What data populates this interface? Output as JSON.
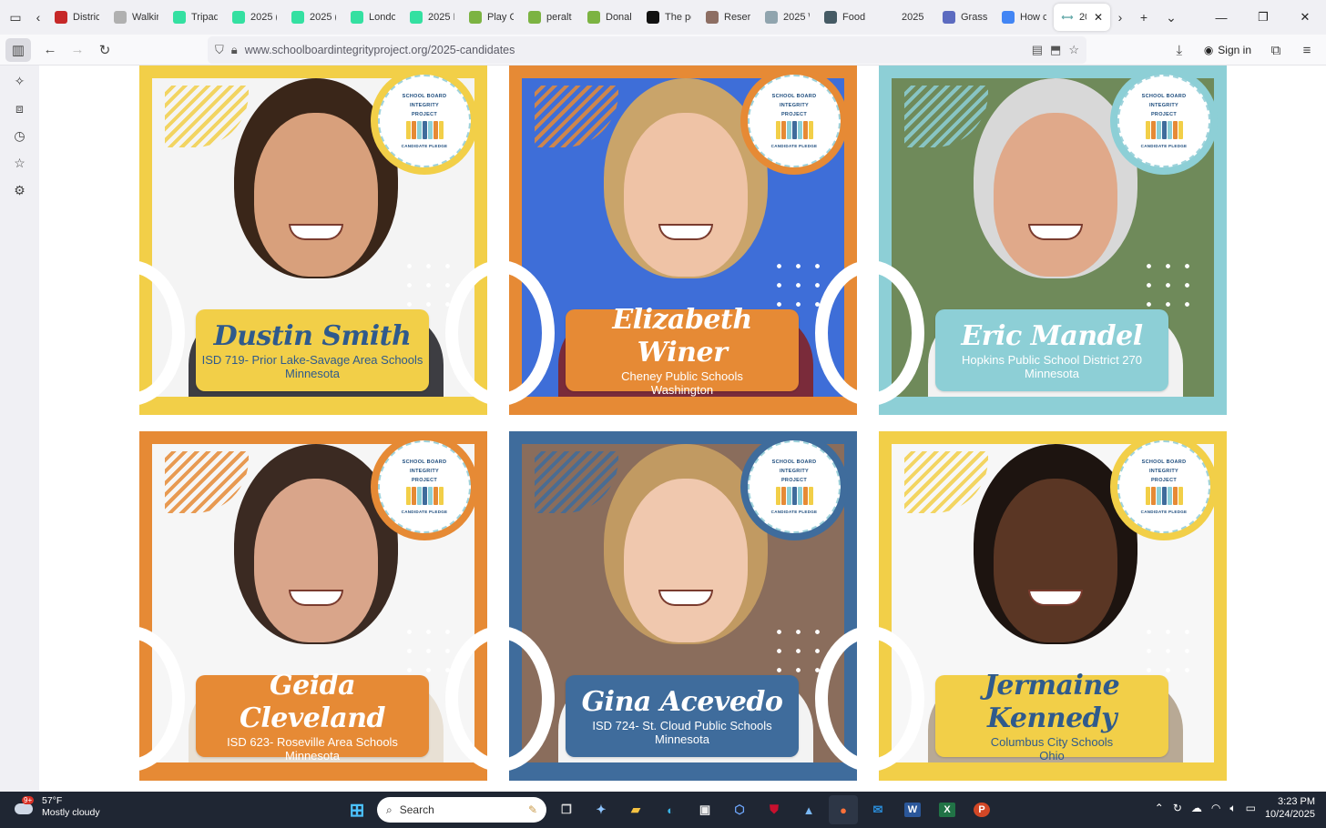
{
  "browser": {
    "tabs": [
      {
        "label": "Distric",
        "fav_color": "#c62828"
      },
      {
        "label": "Walkin",
        "fav_color": "#b0b0b0"
      },
      {
        "label": "Tripad",
        "fav_color": "#34e0a1"
      },
      {
        "label": "2025 (",
        "fav_color": "#34e0a1"
      },
      {
        "label": "2025 (",
        "fav_color": "#34e0a1"
      },
      {
        "label": "Londo",
        "fav_color": "#34e0a1"
      },
      {
        "label": "2025 I",
        "fav_color": "#34e0a1"
      },
      {
        "label": "Play C",
        "fav_color": "#7cb342"
      },
      {
        "label": "peralt",
        "fav_color": "#7cb342"
      },
      {
        "label": "Donal",
        "fav_color": "#7cb342"
      },
      {
        "label": "The pc",
        "fav_color": "#111111"
      },
      {
        "label": "Reserv",
        "fav_color": "#8d6e63"
      },
      {
        "label": "2025 \\",
        "fav_color": "#90a4ae"
      },
      {
        "label": "Food",
        "fav_color": "#455a64"
      },
      {
        "label": "2025",
        "fav_color": "#f0f0f4"
      },
      {
        "label": "Grass",
        "fav_color": "#5c6bc0"
      },
      {
        "label": "How c",
        "fav_color": "#4285f4"
      }
    ],
    "active_tab": {
      "label": "20"
    },
    "url": "www.schoolboardintegrityproject.org/2025-candidates",
    "sign_in": "Sign in"
  },
  "badge": {
    "title_lines": [
      "SCHOOL BOARD",
      "INTEGRITY",
      "PROJECT"
    ],
    "subtitle": "CANDIDATE PLEDGE"
  },
  "candidates": [
    {
      "name": "Dustin Smith",
      "district": "ISD 719- Prior Lake-Savage Area Schools",
      "state": "Minnesota",
      "frame_color": "#f2cf48",
      "plate_color": "#f2cf48",
      "name_color": "#2f5a8c",
      "text_color": "#2f5a8c",
      "bg": "#f4f4f4",
      "skin": "#d8a07c",
      "hair": "#3a2619",
      "shirt": "#3d3d42"
    },
    {
      "name": "Elizabeth Winer",
      "district": "Cheney Public Schools",
      "state": "Washington",
      "frame_color": "#e68a35",
      "plate_color": "#e68a35",
      "name_color": "#ffffff",
      "text_color": "#ffffff",
      "bg": "#3e6ed8",
      "skin": "#efc3a6",
      "hair": "#c9a46a",
      "shirt": "#7a2b3a"
    },
    {
      "name": "Eric Mandel",
      "district": "Hopkins Public School District 270",
      "state": "Minnesota",
      "frame_color": "#8dcfd6",
      "plate_color": "#8dcfd6",
      "name_color": "#ffffff",
      "text_color": "#ffffff",
      "bg": "#6f8a5a",
      "skin": "#e0a98a",
      "hair": "#d8d8d8",
      "shirt": "#f2f2f2"
    },
    {
      "name": "Geida Cleveland",
      "district": "ISD 623- Roseville Area Schools",
      "state": "Minnesota",
      "frame_color": "#e68a35",
      "plate_color": "#e68a35",
      "name_color": "#ffffff",
      "text_color": "#ffffff",
      "bg": "#f6f6f6",
      "skin": "#d9a58a",
      "hair": "#3b2a22",
      "shirt": "#e8e0d4"
    },
    {
      "name": "Gina Acevedo",
      "district": "ISD 724- St. Cloud Public Schools",
      "state": "Minnesota",
      "frame_color": "#3f6c9c",
      "plate_color": "#3f6c9c",
      "name_color": "#ffffff",
      "text_color": "#ffffff",
      "bg": "#8a6d5c",
      "skin": "#f0c8ae",
      "hair": "#c19a62",
      "shirt": "#f3f3f3"
    },
    {
      "name": "Jermaine Kennedy",
      "district": "Columbus City Schools",
      "state": "Ohio",
      "frame_color": "#f2cf48",
      "plate_color": "#f2cf48",
      "name_color": "#2f5a8c",
      "text_color": "#2f5a8c",
      "bg": "#f7f7f7",
      "skin": "#5a3624",
      "hair": "#1d1410",
      "shirt": "#b8a995"
    }
  ],
  "taskbar": {
    "weather_temp": "57°F",
    "weather_desc": "Mostly cloudy",
    "weather_badge": "9+",
    "search_placeholder": "Search",
    "time": "3:23 PM",
    "date": "10/24/2025"
  }
}
